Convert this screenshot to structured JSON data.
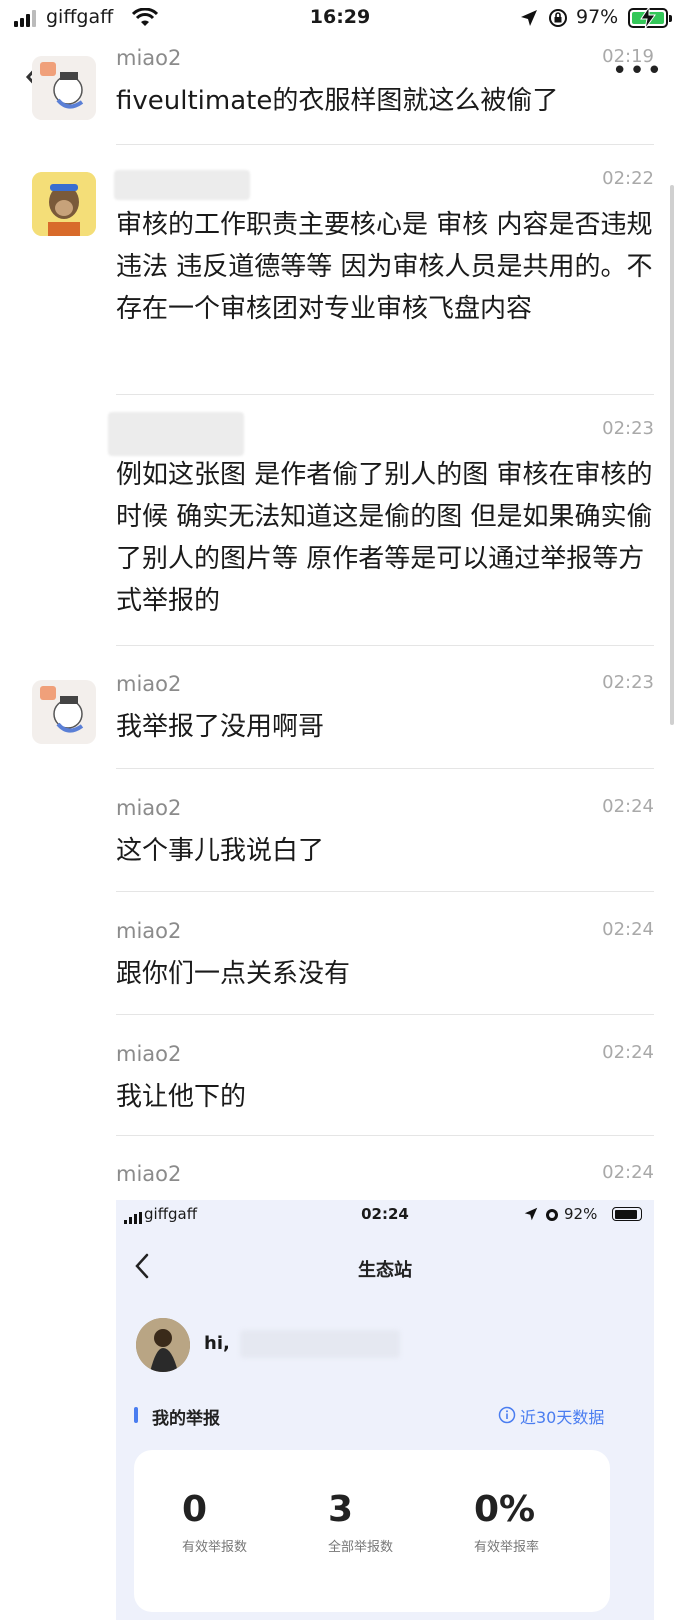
{
  "status_bar": {
    "carrier": "giffgaff",
    "time": "16:29",
    "battery": "97%"
  },
  "messages": [
    {
      "sender": "miao2",
      "time": "02:19",
      "text": "fiveultimate的衣服样图就这么被偷了"
    },
    {
      "sender": "",
      "time": "02:22",
      "text": "审核的工作职责主要核心是 审核 内容是否违规 违法 违反道德等等 因为审核人员是共用的。不存在一个审核团对专业审核飞盘内容"
    },
    {
      "sender": "",
      "time": "02:23",
      "text": "例如这张图 是作者偷了别人的图 审核在审核的时候 确实无法知道这是偷的图 但是如果确实偷了别人的图片等  原作者等是可以通过举报等方式举报的"
    },
    {
      "sender": "miao2",
      "time": "02:23",
      "text": "我举报了没用啊哥"
    },
    {
      "sender": "miao2",
      "time": "02:24",
      "text": "这个事儿我说白了"
    },
    {
      "sender": "miao2",
      "time": "02:24",
      "text": "跟你们一点关系没有"
    },
    {
      "sender": "miao2",
      "time": "02:24",
      "text": "我让他下的"
    },
    {
      "sender": "miao2",
      "time": "02:24",
      "text": ""
    }
  ],
  "screenshot": {
    "carrier": "giffgaff",
    "time": "02:24",
    "battery": "92%",
    "title": "生态站",
    "greeting": "hi,",
    "section_title": "我的举报",
    "range_label": "近30天数据",
    "stats": [
      {
        "value": "0",
        "label": "有效举报数"
      },
      {
        "value": "3",
        "label": "全部举报数"
      },
      {
        "value": "0%",
        "label": "有效举报率"
      }
    ]
  }
}
